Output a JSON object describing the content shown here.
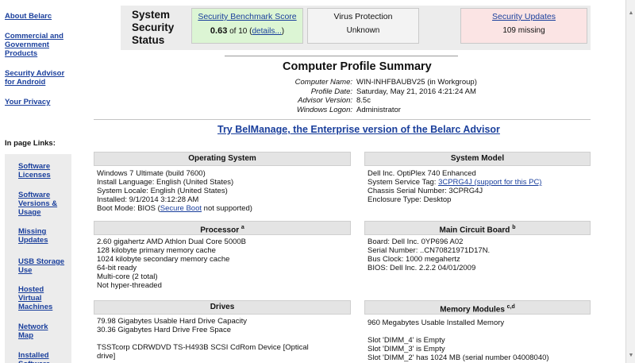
{
  "sidebar": {
    "top_links": [
      "About Belarc",
      "Commercial and Government Products",
      "Security Advisor for Android",
      "Your Privacy"
    ],
    "inpage_title": "In page Links:",
    "inpage_links": [
      "Software Licenses",
      "Software Versions & Usage",
      "Missing Updates",
      "USB Storage Use",
      "Hosted Virtual Machines",
      "Network Map",
      "Installed Software"
    ]
  },
  "status": {
    "title_l1": "System",
    "title_l2": "Security",
    "title_l3": "Status",
    "benchmark": {
      "label": "Security Benchmark Score",
      "score": "0.63",
      "of_text": " of 10 (",
      "details": "details...",
      "close": ")"
    },
    "virus": {
      "label": "Virus Protection",
      "value": "Unknown"
    },
    "updates": {
      "label": "Security Updates",
      "value": "109 missing"
    }
  },
  "summary": {
    "title": "Computer Profile Summary",
    "rows": [
      {
        "key": "Computer Name:",
        "value": "WIN-INHFBAUBV25 (in Workgroup)"
      },
      {
        "key": "Profile Date:",
        "value": "Saturday, May 21, 2016 4:21:24 AM"
      },
      {
        "key": "Advisor Version:",
        "value": "8.5c"
      },
      {
        "key": "Windows Logon:",
        "value": "Administrator"
      }
    ]
  },
  "promo": "Try BelManage, the Enterprise version of the Belarc Advisor",
  "sections": {
    "os": {
      "title": "Operating System",
      "lines": [
        "Windows 7 Ultimate (build 7600)",
        "Install Language: English (United States)",
        "System Locale: English (United States)",
        "Installed: 9/1/2014 3:12:28 AM"
      ],
      "boot_pre": "Boot Mode: BIOS (",
      "boot_link": "Secure Boot",
      "boot_post": " not supported)"
    },
    "model": {
      "title": "System Model",
      "line1": "Dell Inc. OptiPlex 740 Enhanced",
      "tag_pre": "System Service Tag: ",
      "tag_link": "3CPRG4J (support for this PC)",
      "line3": "Chassis Serial Number: 3CPRG4J",
      "line4": "Enclosure Type: Desktop"
    },
    "processor": {
      "title": "Processor",
      "sup": "a",
      "lines": [
        "2.60 gigahertz AMD Athlon Dual Core 5000B",
        "128 kilobyte primary memory cache",
        "1024 kilobyte secondary memory cache",
        "64-bit ready",
        "Multi-core (2 total)",
        "Not hyper-threaded"
      ]
    },
    "board": {
      "title": "Main Circuit Board",
      "sup": "b",
      "lines": [
        "Board: Dell Inc. 0YP696 A02",
        "Serial Number: ..CN70821971D17N.",
        "Bus Clock: 1000 megahertz",
        "BIOS: Dell Inc. 2.2.2 04/01/2009"
      ]
    },
    "drives": {
      "title": "Drives",
      "lines": [
        "79.98 Gigabytes Usable Hard Drive Capacity",
        "30.36 Gigabytes Hard Drive Free Space",
        "",
        "TSSTcorp CDRWDVD TS-H493B SCSI CdRom Device [Optical",
        "drive]"
      ]
    },
    "memory": {
      "title": "Memory Modules",
      "sup": "c,d",
      "lines": [
        "960 Megabytes Usable Installed Memory",
        "",
        "Slot 'DIMM_4' is Empty",
        "Slot 'DIMM_3' is Empty",
        "Slot 'DIMM_2' has 1024 MB (serial number 04008040)"
      ]
    }
  }
}
